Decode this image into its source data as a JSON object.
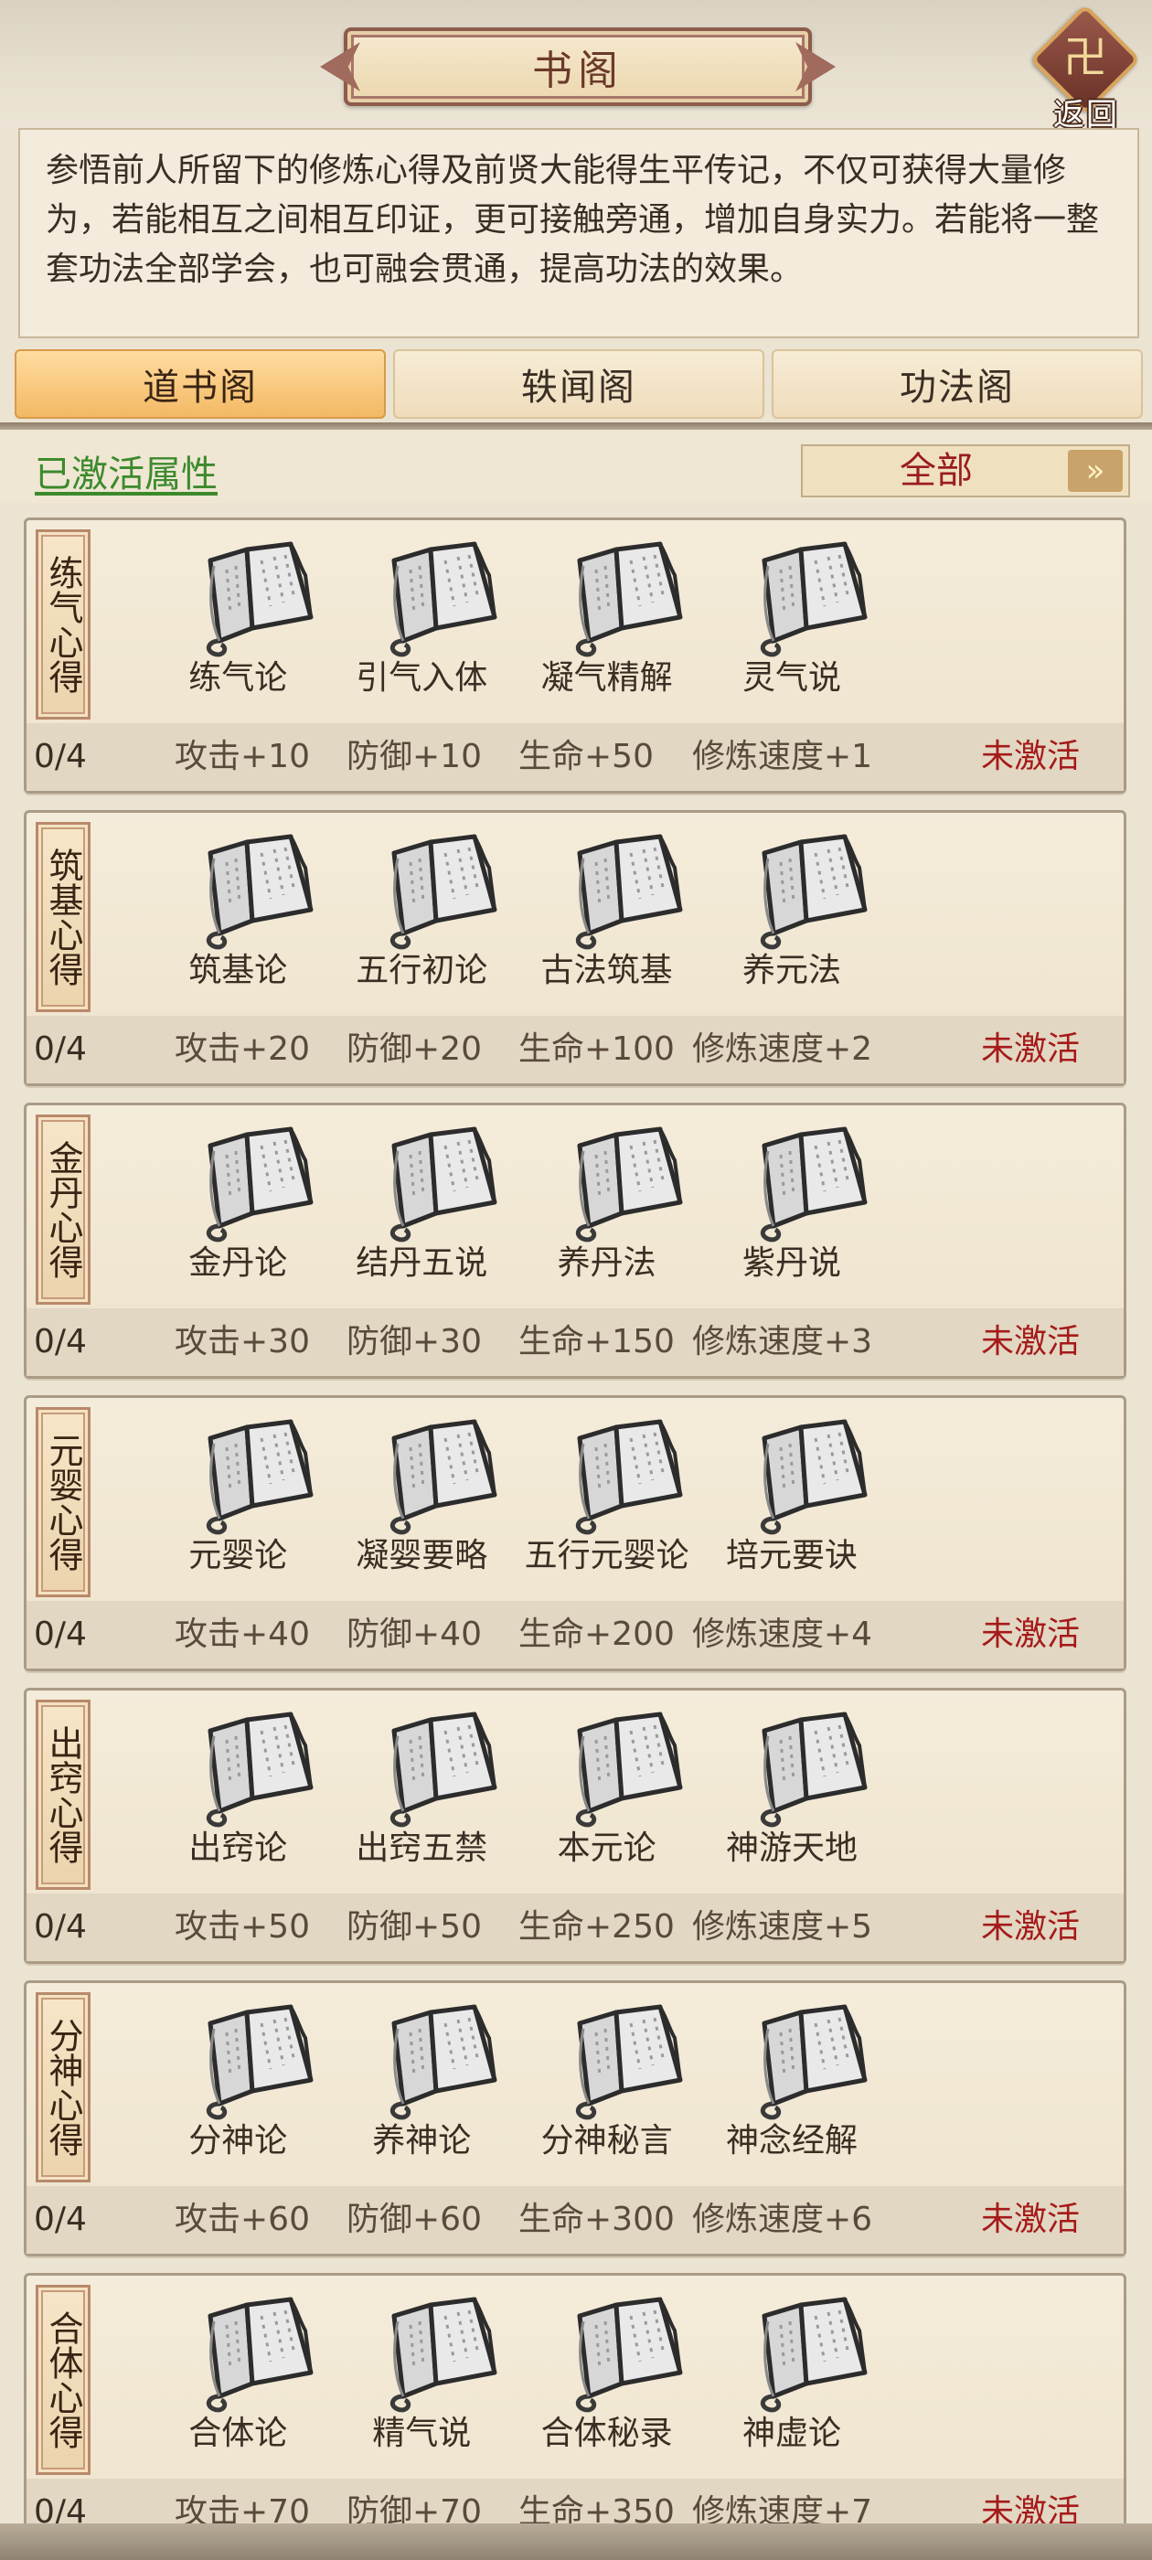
{
  "header": {
    "title": "书阁",
    "back_label": "返回",
    "back_glyph": "卍"
  },
  "description": "参悟前人所留下的修炼心得及前贤大能得生平传记，不仅可获得大量修为，若能相互之间相互印证，更可接触旁通，增加自身实力。若能将一整套功法全部学会，也可融会贯通，提高功法的效果。",
  "tabs": [
    {
      "label": "道书阁",
      "active": true
    },
    {
      "label": "轶闻阁",
      "active": false
    },
    {
      "label": "功法阁",
      "active": false
    }
  ],
  "filter": {
    "activated_label": "已激活属性",
    "select_value": "全部",
    "arrow_glyph": "»"
  },
  "colors": {
    "accent": "#f3b964",
    "status_inactive": "#a51a1a",
    "link_green": "#3c8a2c"
  },
  "groups": [
    {
      "tag": "练气心得",
      "books": [
        "练气论",
        "引气入体",
        "凝气精解",
        "灵气说"
      ],
      "progress": "0/4",
      "attack": "攻击+10",
      "defense": "防御+10",
      "hp": "生命+50",
      "speed": "修炼速度+1",
      "status": "未激活"
    },
    {
      "tag": "筑基心得",
      "books": [
        "筑基论",
        "五行初论",
        "古法筑基",
        "养元法"
      ],
      "progress": "0/4",
      "attack": "攻击+20",
      "defense": "防御+20",
      "hp": "生命+100",
      "speed": "修炼速度+2",
      "status": "未激活"
    },
    {
      "tag": "金丹心得",
      "books": [
        "金丹论",
        "结丹五说",
        "养丹法",
        "紫丹说"
      ],
      "progress": "0/4",
      "attack": "攻击+30",
      "defense": "防御+30",
      "hp": "生命+150",
      "speed": "修炼速度+3",
      "status": "未激活"
    },
    {
      "tag": "元婴心得",
      "books": [
        "元婴论",
        "凝婴要略",
        "五行元婴论",
        "培元要诀"
      ],
      "progress": "0/4",
      "attack": "攻击+40",
      "defense": "防御+40",
      "hp": "生命+200",
      "speed": "修炼速度+4",
      "status": "未激活"
    },
    {
      "tag": "出窍心得",
      "books": [
        "出窍论",
        "出窍五禁",
        "本元论",
        "神游天地"
      ],
      "progress": "0/4",
      "attack": "攻击+50",
      "defense": "防御+50",
      "hp": "生命+250",
      "speed": "修炼速度+5",
      "status": "未激活"
    },
    {
      "tag": "分神心得",
      "books": [
        "分神论",
        "养神论",
        "分神秘言",
        "神念经解"
      ],
      "progress": "0/4",
      "attack": "攻击+60",
      "defense": "防御+60",
      "hp": "生命+300",
      "speed": "修炼速度+6",
      "status": "未激活"
    },
    {
      "tag": "合体心得",
      "books": [
        "合体论",
        "精气说",
        "合体秘录",
        "神虚论"
      ],
      "progress": "0/4",
      "attack": "攻击+70",
      "defense": "防御+70",
      "hp": "生命+350",
      "speed": "修炼速度+7",
      "status": "未激活"
    }
  ],
  "icons": {
    "book": "book-icon",
    "back": "back-icon",
    "dropdown": "chevron-down-icon"
  }
}
